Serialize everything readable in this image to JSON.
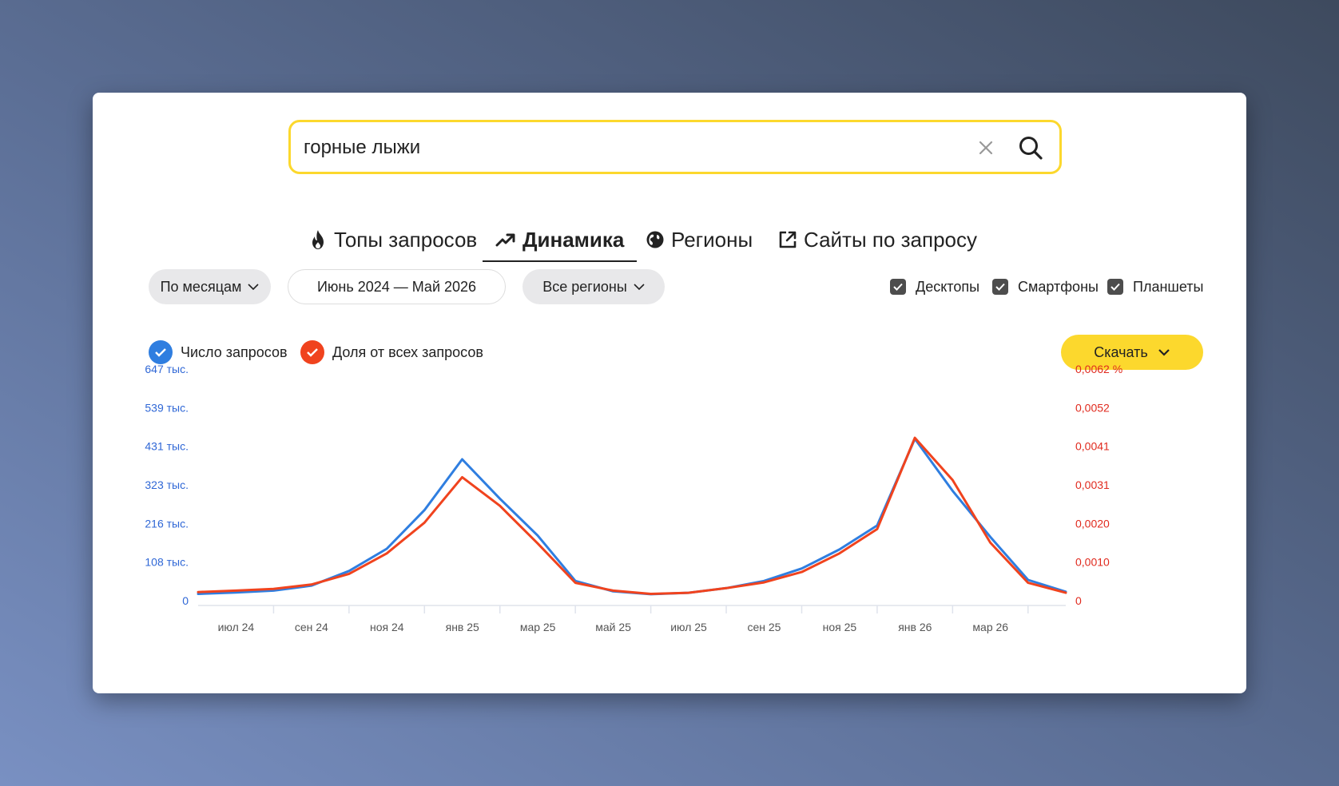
{
  "search": {
    "query": "горные лыжи"
  },
  "tabs": [
    {
      "label": "Топы запросов",
      "icon": "fire-icon"
    },
    {
      "label": "Динамика",
      "icon": "trend-up-icon"
    },
    {
      "label": "Регионы",
      "icon": "globe-icon"
    },
    {
      "label": "Сайты по запросу",
      "icon": "external-link-icon"
    }
  ],
  "active_tab": "Динамика",
  "filters": {
    "grouping": "По месяцам",
    "period": "Июнь 2024 — Май 2026",
    "region": "Все регионы"
  },
  "devices": [
    {
      "label": "Десктопы",
      "checked": true
    },
    {
      "label": "Смартфоны",
      "checked": true
    },
    {
      "label": "Планшеты",
      "checked": true
    }
  ],
  "legend": {
    "count_label": "Число запросов",
    "share_label": "Доля от всех запросов"
  },
  "download_label": "Скачать",
  "colors": {
    "accent_yellow": "#fcd82d",
    "count_series": "#2f7ee0",
    "share_series": "#f0431e"
  },
  "chart_data": {
    "type": "line",
    "x_tick_labels": [
      "июл 24",
      "сен 24",
      "ноя 24",
      "янв 25",
      "мар 25",
      "май 25",
      "июл 25",
      "сен 25",
      "ноя 25",
      "янв 26",
      "мар 26"
    ],
    "x": [
      "июн 24",
      "июл 24",
      "авг 24",
      "сен 24",
      "окт 24",
      "ноя 24",
      "дек 24",
      "янв 25",
      "фев 25",
      "мар 25",
      "апр 25",
      "май 25",
      "июн 25",
      "июл 25",
      "авг 25",
      "сен 25",
      "окт 25",
      "ноя 25",
      "дек 25",
      "янв 26",
      "фев 26",
      "мар 26",
      "апр 26",
      "май 26"
    ],
    "left_axis": {
      "ticks": [
        "0",
        "108 тыс.",
        "216 тыс.",
        "323 тыс.",
        "431 тыс.",
        "539 тыс.",
        "647 тыс."
      ],
      "ylim": [
        0,
        647000
      ]
    },
    "right_axis": {
      "ticks": [
        "0",
        "0,0010",
        "0,0020",
        "0,0031",
        "0,0041",
        "0,0052",
        "0,0062 %"
      ],
      "ylim": [
        0,
        0.0062
      ]
    },
    "series": [
      {
        "name": "Число запросов",
        "axis": "left",
        "values": [
          19000,
          23000,
          28000,
          42000,
          83000,
          145000,
          253000,
          395000,
          285000,
          182000,
          55000,
          26000,
          18000,
          22000,
          35000,
          55000,
          90000,
          143000,
          210000,
          452000,
          307000,
          178000,
          58000,
          25000
        ]
      },
      {
        "name": "Доля от всех запросов",
        "axis": "left",
        "values": [
          24000,
          28000,
          33000,
          45000,
          75000,
          132000,
          218000,
          345000,
          265000,
          160000,
          50000,
          28000,
          19000,
          22000,
          35000,
          51000,
          80000,
          132000,
          200000,
          455000,
          337000,
          162000,
          50000,
          22000
        ]
      }
    ],
    "grid": false
  }
}
